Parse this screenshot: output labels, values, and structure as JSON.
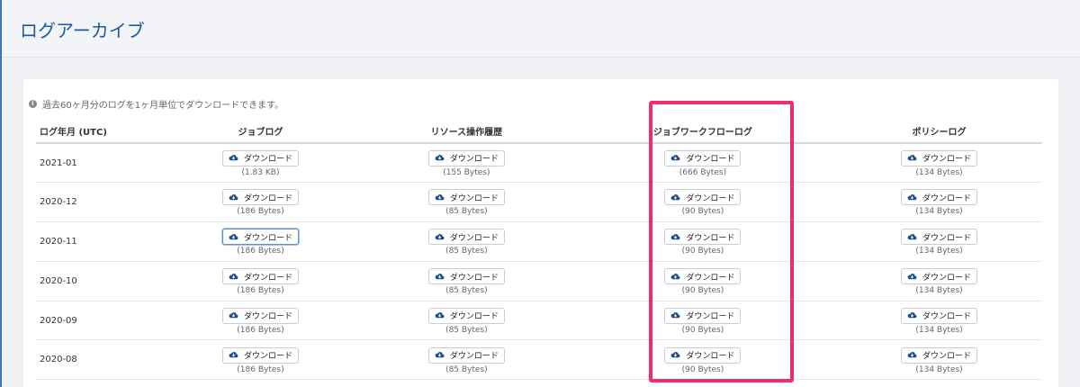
{
  "header": {
    "title": "ログアーカイブ"
  },
  "notice": {
    "icon": "info-icon",
    "text": "過去60ヶ月分のログを1ヶ月単位でダウンロードできます。"
  },
  "table": {
    "columns": [
      "ログ年月 (UTC)",
      "ジョブログ",
      "リソース操作履歴",
      "ジョブワークフローログ",
      "ポリシーログ"
    ],
    "download_label": "ダウンロード",
    "rows": [
      {
        "month": "2021-01",
        "sizes": [
          "(1.83 KB)",
          "(155 Bytes)",
          "(666 Bytes)",
          "(134 Bytes)"
        ]
      },
      {
        "month": "2020-12",
        "sizes": [
          "(186 Bytes)",
          "(85 Bytes)",
          "(90 Bytes)",
          "(134 Bytes)"
        ]
      },
      {
        "month": "2020-11",
        "sizes": [
          "(186 Bytes)",
          "(85 Bytes)",
          "(90 Bytes)",
          "(134 Bytes)"
        ]
      },
      {
        "month": "2020-10",
        "sizes": [
          "(186 Bytes)",
          "(85 Bytes)",
          "(90 Bytes)",
          "(134 Bytes)"
        ]
      },
      {
        "month": "2020-09",
        "sizes": [
          "(186 Bytes)",
          "(85 Bytes)",
          "(90 Bytes)",
          "(134 Bytes)"
        ]
      },
      {
        "month": "2020-08",
        "sizes": [
          "(186 Bytes)",
          "(85 Bytes)",
          "(90 Bytes)",
          "(134 Bytes)"
        ]
      }
    ]
  },
  "colors": {
    "accent": "#1f5a9e",
    "icon": "#1b4f8a",
    "highlight": "#ee2d6b"
  }
}
